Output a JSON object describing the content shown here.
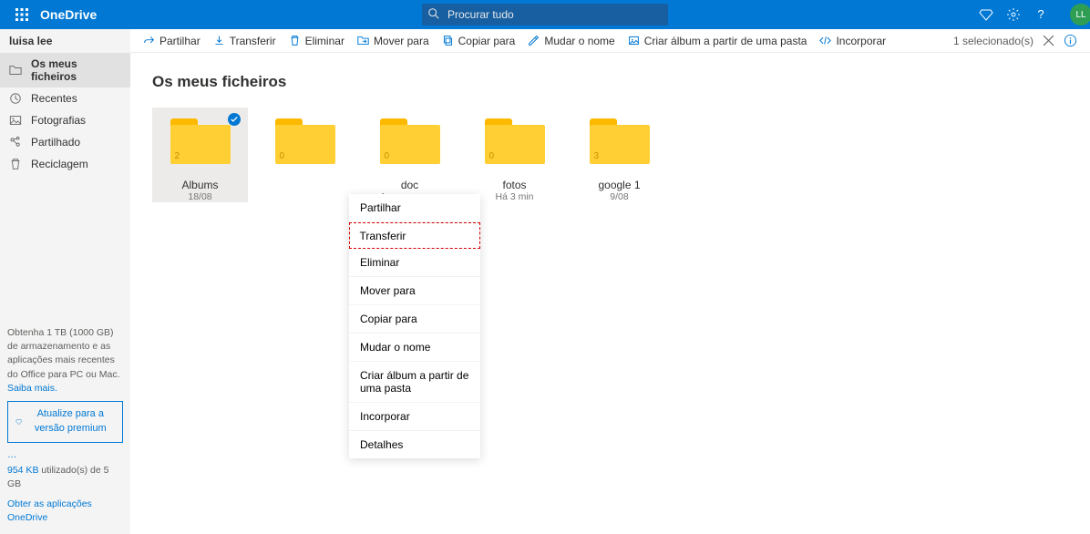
{
  "header": {
    "brand": "OneDrive",
    "search_placeholder": "Procurar tudo",
    "avatar_initials": "LL"
  },
  "sidebar": {
    "user": "luisa lee",
    "items": [
      {
        "label": "Os meus ficheiros",
        "icon": "folder",
        "active": true
      },
      {
        "label": "Recentes",
        "icon": "clock",
        "active": false
      },
      {
        "label": "Fotografias",
        "icon": "photo",
        "active": false
      },
      {
        "label": "Partilhado",
        "icon": "share",
        "active": false
      },
      {
        "label": "Reciclagem",
        "icon": "trash",
        "active": false
      }
    ],
    "promo_line": "Obtenha 1 TB (1000 GB) de armazenamento e as aplicações mais recentes do Office para PC ou Mac.",
    "promo_link": "Saiba mais.",
    "premium_button": "Atualize para a versão premium",
    "storage_used": "954 KB",
    "storage_suffix": " utilizado(s) de 5 GB",
    "get_apps": "Obter as aplicações OneDrive"
  },
  "commandbar": {
    "items": [
      {
        "label": "Partilhar",
        "icon": "share"
      },
      {
        "label": "Transferir",
        "icon": "download"
      },
      {
        "label": "Eliminar",
        "icon": "delete"
      },
      {
        "label": "Mover para",
        "icon": "move"
      },
      {
        "label": "Copiar para",
        "icon": "copy"
      },
      {
        "label": "Mudar o nome",
        "icon": "rename"
      },
      {
        "label": "Criar álbum a partir de uma pasta",
        "icon": "album"
      },
      {
        "label": "Incorporar",
        "icon": "embed"
      }
    ],
    "selection": "1 selecionado(s)"
  },
  "page": {
    "title": "Os meus ficheiros",
    "folders": [
      {
        "name": "Albums",
        "date": "18/08",
        "count": "2",
        "selected": true
      },
      {
        "name": "",
        "date": "",
        "count": "0",
        "selected": false
      },
      {
        "name": "doc",
        "date": "Agora mesmo",
        "count": "0",
        "selected": false
      },
      {
        "name": "fotos",
        "date": "Há 3 min",
        "count": "0",
        "selected": false
      },
      {
        "name": "google 1",
        "date": "9/08",
        "count": "3",
        "selected": false
      }
    ]
  },
  "context_menu": {
    "items": [
      "Partilhar",
      "Transferir",
      "Eliminar",
      "Mover para",
      "Copiar para",
      "Mudar o nome",
      "Criar álbum a partir de uma pasta",
      "Incorporar",
      "Detalhes"
    ],
    "highlighted_index": 1
  }
}
